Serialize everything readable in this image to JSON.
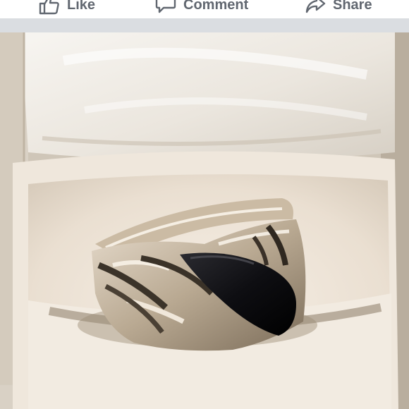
{
  "actions": {
    "like_label": "Like",
    "comment_label": "Comment",
    "share_label": "Share"
  },
  "icons": {
    "like": "thumbs-up-icon",
    "comment": "speech-bubble-icon",
    "share": "share-arrow-icon"
  },
  "colors": {
    "action_text": "#616770",
    "divider": "#dadde1"
  }
}
